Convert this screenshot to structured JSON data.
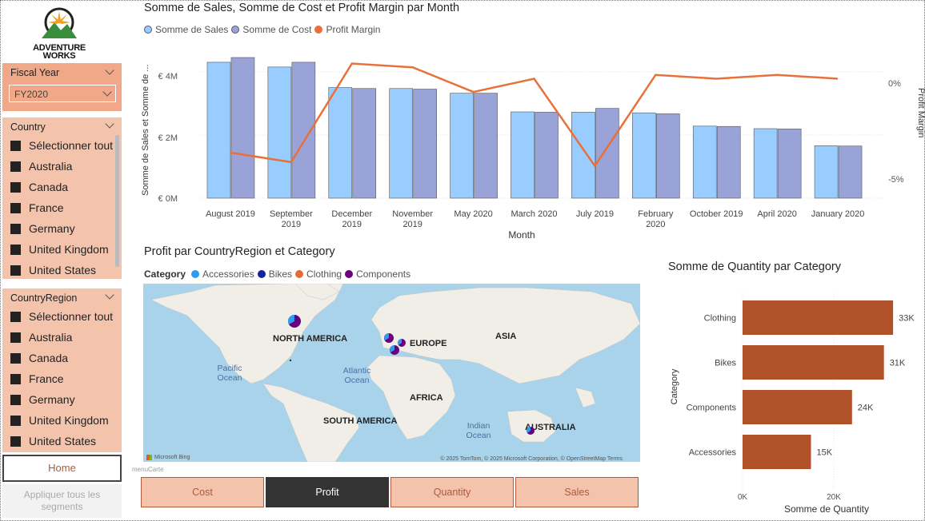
{
  "logo": {
    "line1": "ADVENTURE",
    "line2": "WORKS"
  },
  "fiscal_year": {
    "header": "Fiscal Year",
    "value": "FY2020"
  },
  "country_slicer": {
    "header": "Country",
    "items": [
      "Sélectionner tout",
      "Australia",
      "Canada",
      "France",
      "Germany",
      "United Kingdom",
      "United States"
    ]
  },
  "region_slicer": {
    "header": "CountryRegion",
    "items": [
      "Sélectionner tout",
      "Australia",
      "Canada",
      "France",
      "Germany",
      "United Kingdom",
      "United States"
    ]
  },
  "buttons": {
    "home": "Home",
    "apply": "Appliquer tous les segments"
  },
  "combo_chart": {
    "title": "Somme de Sales, Somme de Cost et Profit Margin par Month",
    "legend": [
      "Somme de Sales",
      "Somme de Cost",
      "Profit Margin"
    ],
    "ylabel": "Somme de Sales et Somme de ...",
    "y2label": "Profit Margin",
    "xlabel": "Month",
    "y_ticks": [
      "€ 4M",
      "€ 2M",
      "€ 0M"
    ],
    "y2_ticks": [
      "0%",
      "-5%"
    ]
  },
  "map_chart": {
    "title": "Profit par CountryRegion et Category",
    "legend_title": "Category",
    "legend": [
      "Accessories",
      "Bikes",
      "Clothing",
      "Components"
    ],
    "continents": [
      "NORTH AMERICA",
      "EUROPE",
      "ASIA",
      "AFRICA",
      "SOUTH AMERICA",
      "AUSTRALIA"
    ],
    "oceans": [
      "Pacific Ocean",
      "Atlantic Ocean",
      "Indian Ocean"
    ],
    "attribution": "© 2025 TomTom, © 2025 Microsoft Corporation, © OpenStreetMap  Terms",
    "brand": "Microsoft Bing"
  },
  "tabs": {
    "label": "menuCarte",
    "items": [
      "Cost",
      "Profit",
      "Quantity",
      "Sales"
    ],
    "active": "Profit"
  },
  "bar_chart": {
    "title": "Somme de Quantity par Category",
    "xlabel": "Somme de Quantity",
    "ylabel": "Category",
    "x_ticks": [
      "0K",
      "20K"
    ]
  },
  "colors": {
    "sales": "#99ccff",
    "cost": "#9aa3d8",
    "margin": "#e8703a",
    "bar": "#b05129",
    "accessories": "#2d9bf0",
    "bikes": "#12239e",
    "clothing": "#e66c37",
    "components": "#6b007b"
  },
  "chart_data": [
    {
      "type": "bar",
      "categories": [
        "August 2019",
        "September 2019",
        "December 2019",
        "November 2019",
        "May 2020",
        "March 2020",
        "July 2019",
        "February 2020",
        "October 2019",
        "April 2020",
        "January 2020"
      ],
      "series": [
        {
          "name": "Somme de Sales",
          "values": [
            4.3,
            4.15,
            3.5,
            3.47,
            3.32,
            2.73,
            2.72,
            2.7,
            2.28,
            2.2,
            1.66
          ]
        },
        {
          "name": "Somme de Cost",
          "values": [
            4.45,
            4.3,
            3.47,
            3.45,
            3.32,
            2.72,
            2.84,
            2.67,
            2.27,
            2.19,
            1.65
          ]
        },
        {
          "name": "Profit Margin",
          "values": [
            -3.6,
            -4.1,
            1.1,
            0.9,
            -0.4,
            0.3,
            -4.3,
            0.5,
            0.3,
            0.5,
            0.3
          ]
        }
      ],
      "title": "Somme de Sales, Somme de Cost et Profit Margin par Month",
      "xlabel": "Month",
      "ylabel": "Somme de Sales et Somme de ...",
      "ylim": [
        0,
        4.5
      ],
      "y2lim": [
        -6,
        1.5
      ]
    },
    {
      "type": "bar",
      "orientation": "horizontal",
      "categories": [
        "Clothing",
        "Bikes",
        "Components",
        "Accessories"
      ],
      "values": [
        33,
        31,
        24,
        15
      ],
      "value_labels": [
        "33K",
        "31K",
        "24K",
        "15K"
      ],
      "title": "Somme de Quantity par Category",
      "xlabel": "Somme de Quantity",
      "ylabel": "Category",
      "xlim": [
        0,
        34
      ]
    }
  ]
}
